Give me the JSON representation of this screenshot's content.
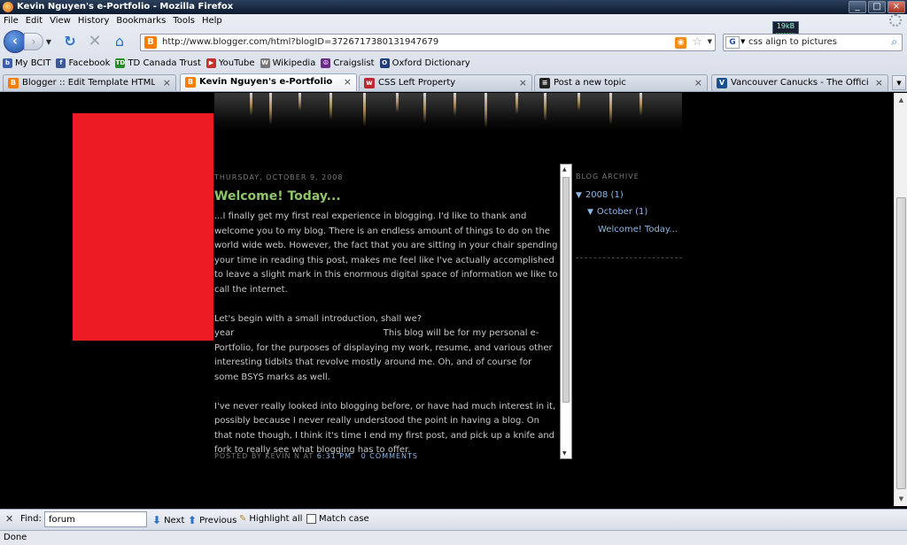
{
  "window": {
    "title": "Kevin Nguyen's e-Portfolio - Mozilla Firefox",
    "controls": [
      "_",
      "□",
      "×"
    ]
  },
  "menubar": [
    "File",
    "Edit",
    "View",
    "History",
    "Bookmarks",
    "Tools",
    "Help"
  ],
  "throbber_label": "19kB",
  "nav": {
    "url": "http://www.blogger.com/html?blogID=3726717380131947679",
    "search_engine": "G",
    "search_query": "css align to pictures"
  },
  "bookmarks": [
    {
      "label": "My BCIT",
      "icon": "bcit-icon",
      "color": "#3a5fa8",
      "glyph": "b"
    },
    {
      "label": "Facebook",
      "icon": "facebook-icon",
      "color": "#3b5998",
      "glyph": "f"
    },
    {
      "label": "TD Canada Trust",
      "icon": "td-icon",
      "color": "#2a8a2a",
      "glyph": "TD"
    },
    {
      "label": "YouTube",
      "icon": "youtube-icon",
      "color": "#c4302b",
      "glyph": "▶"
    },
    {
      "label": "Wikipedia",
      "icon": "wikipedia-icon",
      "color": "#777777",
      "glyph": "W"
    },
    {
      "label": "Craigslist",
      "icon": "craigslist-icon",
      "color": "#6a2b8a",
      "glyph": "☮"
    },
    {
      "label": "Oxford Dictionary",
      "icon": "oxford-icon",
      "color": "#1f3f7a",
      "glyph": "O"
    }
  ],
  "tabs": [
    {
      "label": "Blogger :: Edit Template HTML",
      "icon_color": "#f57d00",
      "glyph": "B",
      "active": false
    },
    {
      "label": "Kevin Nguyen's e-Portfolio",
      "icon_color": "#f57d00",
      "glyph": "B",
      "active": true
    },
    {
      "label": "CSS Left Property",
      "icon_color": "#c0262d",
      "glyph": "w",
      "active": false
    },
    {
      "label": "Post a new topic",
      "icon_color": "#222222",
      "glyph": "≡",
      "active": false
    },
    {
      "label": "Vancouver Canucks - The Official ...",
      "icon_color": "#1a4f8f",
      "glyph": "V",
      "active": false
    }
  ],
  "post": {
    "date": "Thursday, October 9, 2008",
    "title": "Welcome! Today...",
    "paragraphs": [
      "...I finally get my first real experience in blogging. I'd like to thank and welcome you to my blog. There is an endless amount of things to do on the world wide web. However, the fact that you are sitting in your chair spending your time in reading this post, makes me feel like I've actually accomplished to leave a slight mark in this enormous digital space of information we like to call the internet.",
      "Let's begin with a small introduction, shall we?\nyear                                                     This blog will be for my personal e-Portfolio, for the purposes of displaying my work, resume, and various other interesting tidbits that revolve mostly around me. Oh, and of course for some BSYS marks as well.",
      "I've never really looked into blogging before, or have had much interest in it, possibly because I never really understood the point in having a blog. On that note though, I think it's time I end my first post, and pick up a knife and fork to really see what blogging has to offer."
    ],
    "footer_prefix": "POSTED BY KEVIN N AT",
    "time": "6:31 PM",
    "comments": "0 COMMENTS"
  },
  "sidebar": {
    "heading": "BLOG ARCHIVE",
    "year": "2008 (1)",
    "month": "October (1)",
    "entry": "Welcome! Today..."
  },
  "findbar": {
    "label": "Find:",
    "query": "forum",
    "next": "Next",
    "previous": "Previous",
    "highlight": "Highlight all",
    "match_case": "Match case"
  },
  "status": "Done",
  "colors": {
    "red_box": "#ed1c24",
    "post_title": "#8fc56a",
    "link": "#8fb8e8"
  }
}
